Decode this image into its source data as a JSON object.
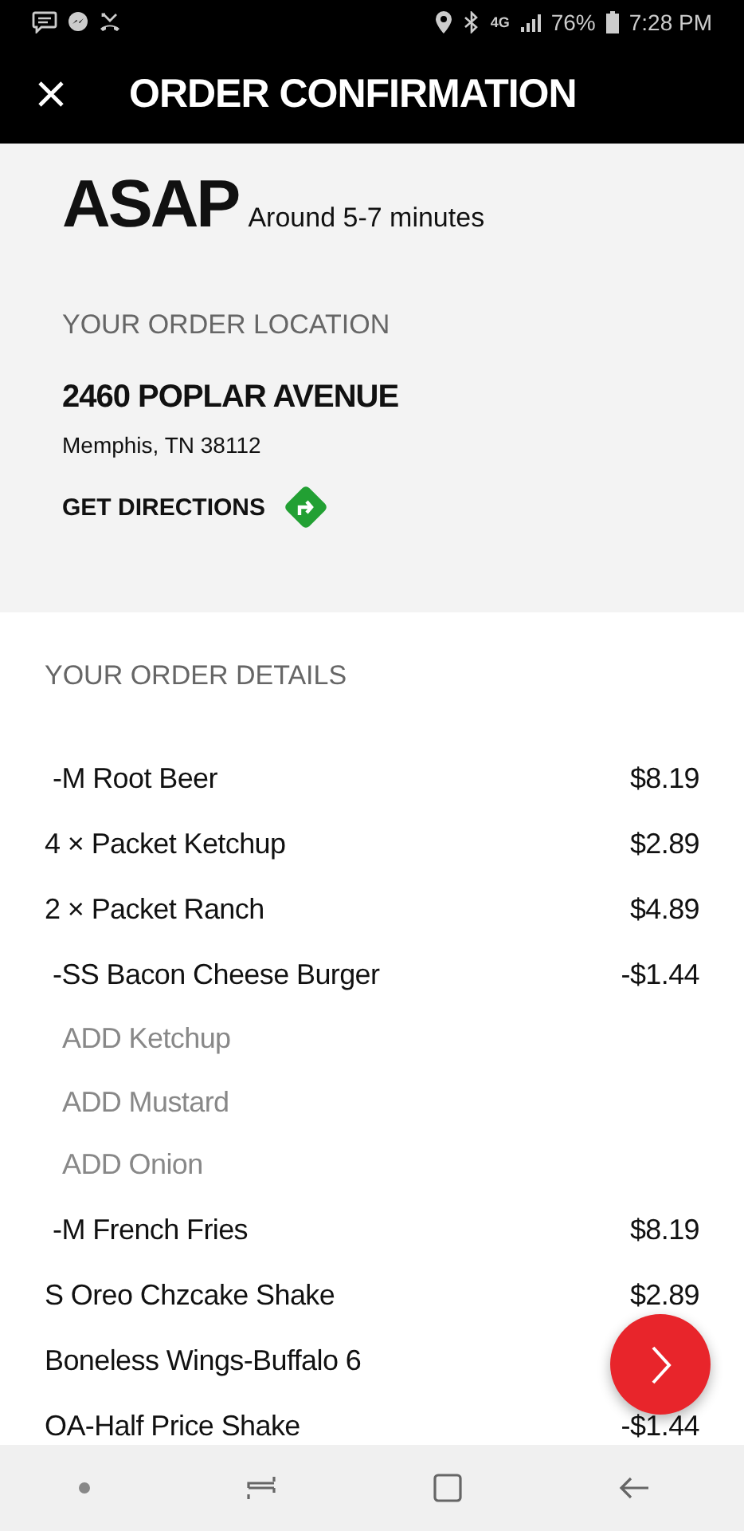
{
  "status_bar": {
    "network": "4G",
    "battery": "76%",
    "time": "7:28 PM"
  },
  "header": {
    "title": "ORDER CONFIRMATION"
  },
  "timing": {
    "title": "ASAP",
    "estimate": "Around 5-7 minutes"
  },
  "location": {
    "heading": "YOUR ORDER LOCATION",
    "street": "2460 POPLAR AVENUE",
    "city": "Memphis, TN 38112",
    "directions": "GET DIRECTIONS"
  },
  "details": {
    "heading": "YOUR ORDER DETAILS",
    "items": [
      {
        "kind": "sub",
        "name": "-M Root Beer",
        "price": "$8.19"
      },
      {
        "kind": "item",
        "name": "4 × Packet Ketchup",
        "price": "$2.89"
      },
      {
        "kind": "item",
        "name": "2 × Packet Ranch",
        "price": "$4.89"
      },
      {
        "kind": "sub",
        "name": "-SS Bacon Cheese Burger",
        "price": "-$1.44"
      },
      {
        "kind": "modifier",
        "name": "ADD Ketchup"
      },
      {
        "kind": "modifier",
        "name": "ADD Mustard"
      },
      {
        "kind": "modifier",
        "name": "ADD Onion"
      },
      {
        "kind": "sub",
        "name": "-M French Fries",
        "price": "$8.19"
      },
      {
        "kind": "item",
        "name": "S Oreo Chzcake Shake",
        "price": "$2.89"
      },
      {
        "kind": "item",
        "name": "Boneless Wings-Buffalo 6"
      },
      {
        "kind": "item",
        "name": "OA-Half Price Shake",
        "price": "-$1.44"
      }
    ]
  }
}
